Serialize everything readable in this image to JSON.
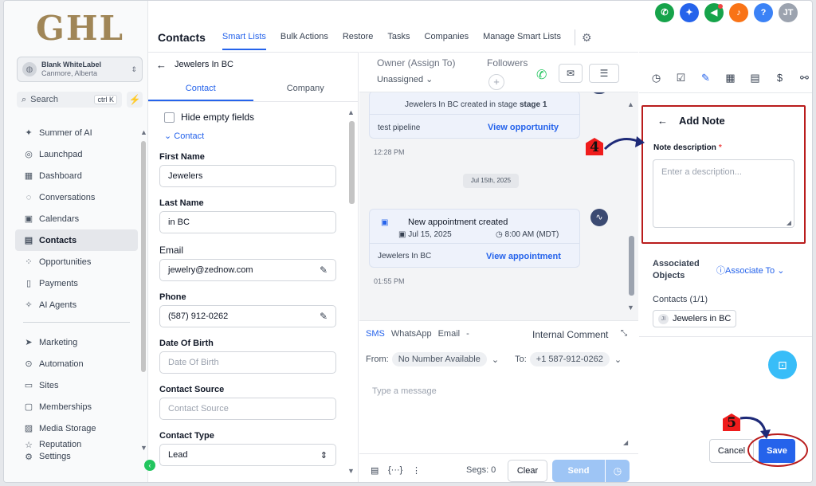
{
  "logo": "GHL",
  "account": {
    "name": "Blank WhiteLabel",
    "location": "Canmore, Alberta"
  },
  "search": {
    "label": "Search",
    "shortcut": "ctrl K"
  },
  "nav": {
    "items": [
      "Summer of AI",
      "Launchpad",
      "Dashboard",
      "Conversations",
      "Calendars",
      "Contacts",
      "Opportunities",
      "Payments",
      "AI Agents"
    ],
    "items2": [
      "Marketing",
      "Automation",
      "Sites",
      "Memberships",
      "Media Storage",
      "Reputation"
    ],
    "settings": "Settings"
  },
  "topbar": {
    "title": "Contacts",
    "tabs": [
      "Smart Lists",
      "Bulk Actions",
      "Restore",
      "Tasks",
      "Companies",
      "Manage Smart Lists"
    ],
    "avatar": "JT"
  },
  "contact": {
    "header": "Jewelers In BC",
    "tabs": [
      "Contact",
      "Company"
    ],
    "hide_empty": "Hide empty fields",
    "section": "Contact",
    "fields": {
      "first_name_label": "First Name",
      "first_name": "Jewelers",
      "last_name_label": "Last Name",
      "last_name": "in BC",
      "email_label": "Email",
      "email": "jewelry@zednow.com",
      "phone_label": "Phone",
      "phone": "(587) 912-0262",
      "dob_label": "Date Of Birth",
      "dob_placeholder": "Date Of Birth",
      "source_label": "Contact Source",
      "source_placeholder": "Contact Source",
      "type_label": "Contact Type",
      "type": "Lead"
    }
  },
  "conversation": {
    "owner_label": "Owner (Assign To)",
    "owner_value": "Unassigned",
    "followers_label": "Followers",
    "card1": {
      "subtitle": "Jewelers In BC created in stage",
      "stage": "stage 1",
      "pipeline": "test pipeline",
      "link": "View opportunity",
      "time": "12:28 PM"
    },
    "date_divider": "Jul 15th, 2025",
    "card2": {
      "title": "New appointment created",
      "date": "Jul 15, 2025",
      "time_range": "8:00 AM (MDT)",
      "contact": "Jewelers In BC",
      "link": "View appointment",
      "time": "01:55 PM"
    },
    "composer": {
      "tabs": [
        "SMS",
        "WhatsApp",
        "Email",
        "-"
      ],
      "internal": "Internal Comment",
      "from_label": "From:",
      "from_value": "No Number Available",
      "to_label": "To:",
      "to_value": "+1 587-912-0262",
      "placeholder": "Type a message",
      "segs": "Segs: 0",
      "clear": "Clear",
      "send": "Send"
    }
  },
  "note": {
    "title": "Add Note",
    "desc_label": "Note description",
    "required": "*",
    "placeholder": "Enter a description...",
    "assoc_label_1": "Associated",
    "assoc_label_2": "Objects",
    "assoc_link": "Associate To",
    "contacts_count": "Contacts (1/1)",
    "contact_initials": "JI",
    "contact_name": "Jewelers in BC",
    "cancel": "Cancel",
    "save": "Save"
  },
  "annotations": {
    "step4": "4",
    "step5": "5"
  },
  "colors": {
    "accent": "#2563eb",
    "highlight": "#b91c1c",
    "logo": "#a08657"
  }
}
